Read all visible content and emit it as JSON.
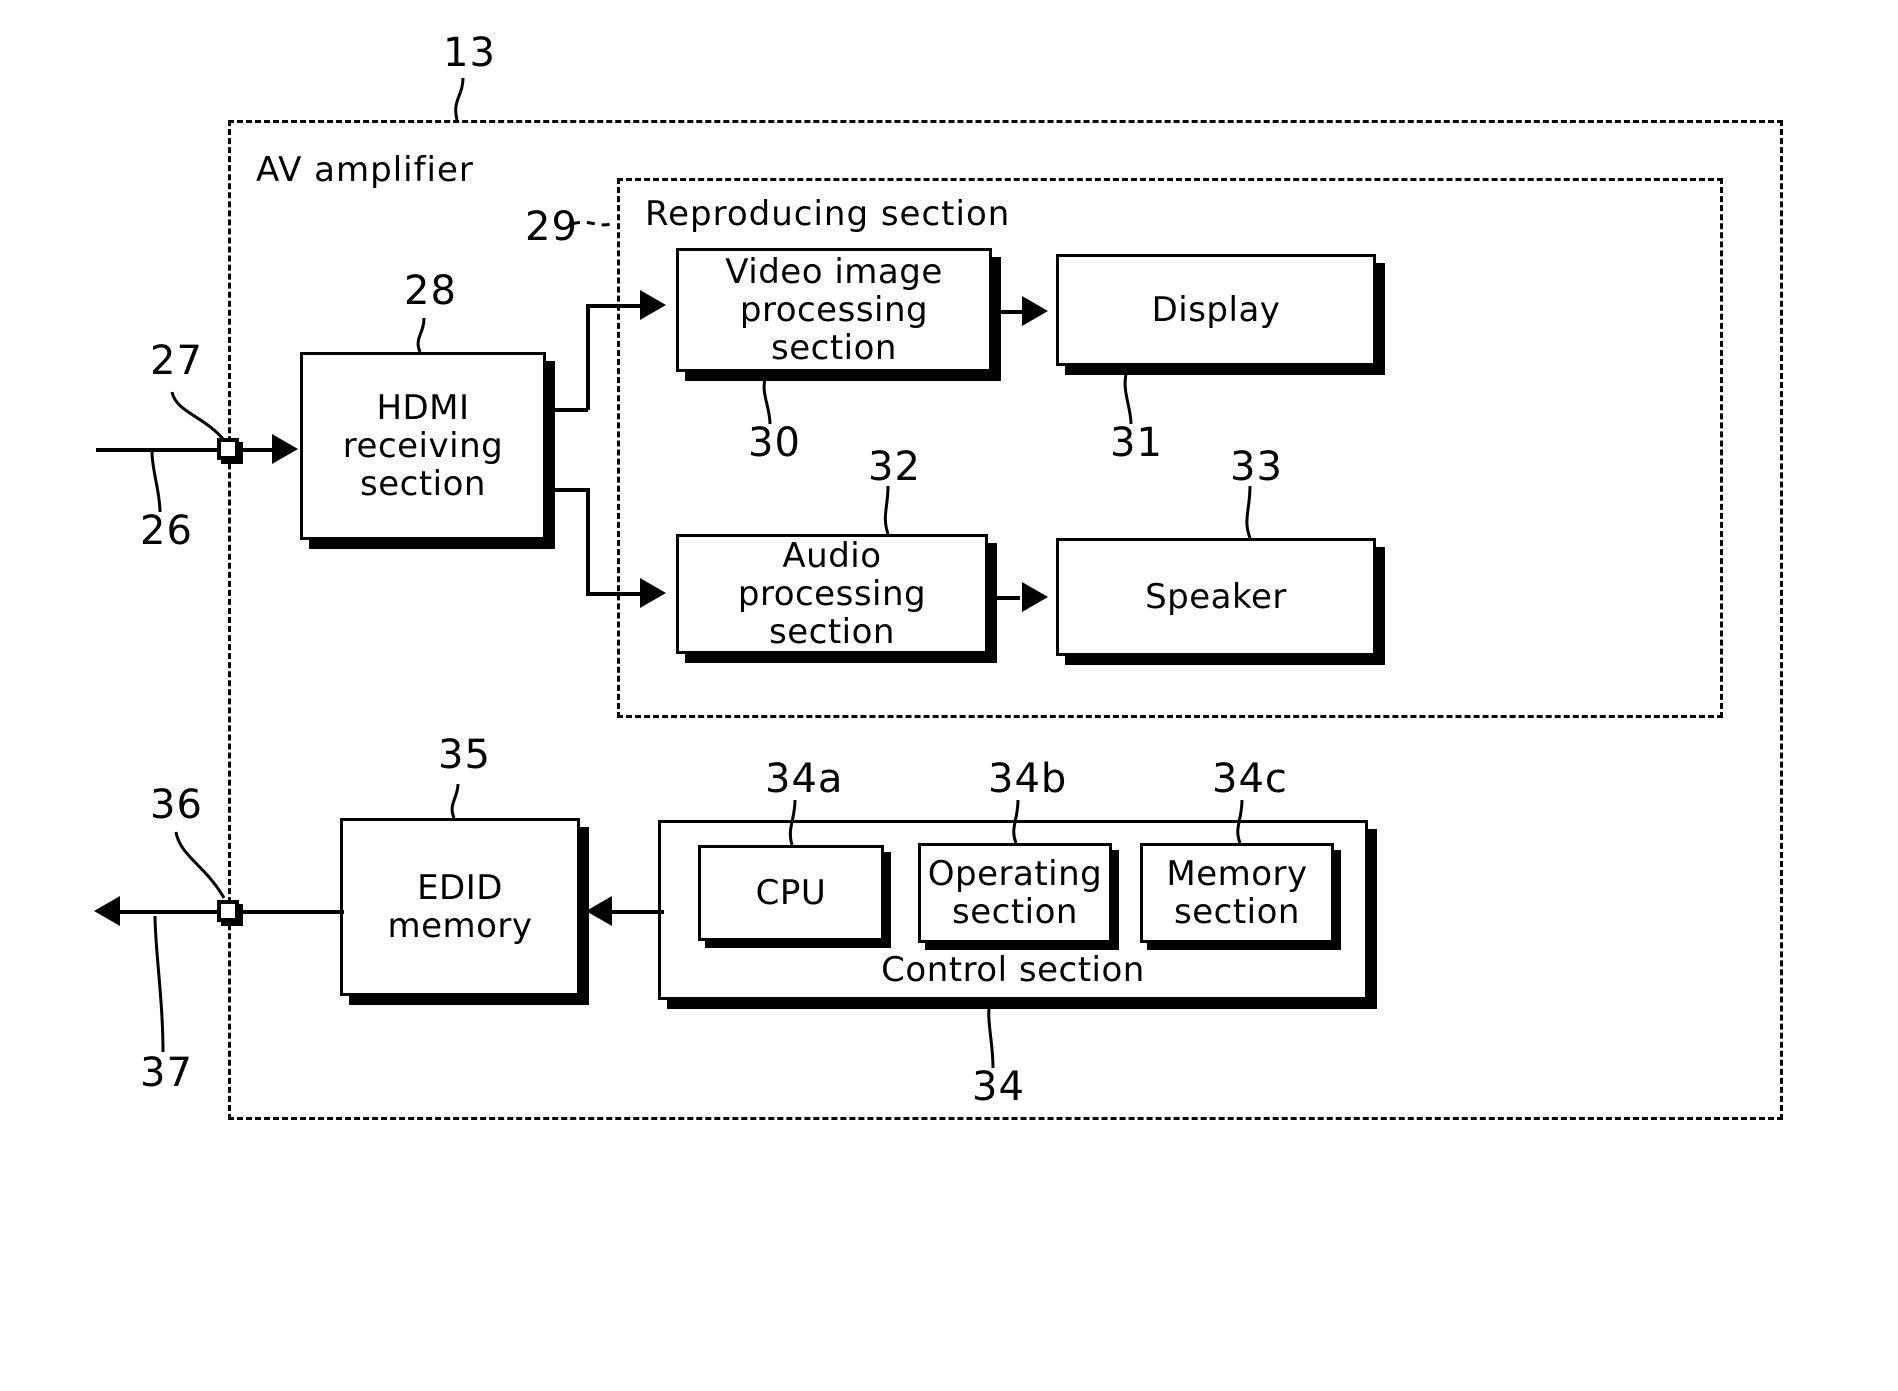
{
  "figure": {
    "type": "block-diagram",
    "outer": {
      "label": "AV amplifier",
      "ref": "13"
    },
    "reproducing": {
      "label": "Reproducing section",
      "ref": "29"
    },
    "control": {
      "label": "Control section",
      "ref": "34"
    },
    "blocks": [
      {
        "id": "hdmi",
        "label": "HDMI\nreceiving\nsection",
        "ref": "28"
      },
      {
        "id": "video",
        "label": "Video  image\nprocessing  section",
        "ref": "30"
      },
      {
        "id": "display",
        "label": "Display",
        "ref": "31"
      },
      {
        "id": "audio",
        "label": "Audio  processing\nsection",
        "ref": "32"
      },
      {
        "id": "speaker",
        "label": "Speaker",
        "ref": "33"
      },
      {
        "id": "edid",
        "label": "EDID\nmemory",
        "ref": "35"
      },
      {
        "id": "cpu",
        "label": "CPU",
        "ref": "34a"
      },
      {
        "id": "operating",
        "label": "Operating\nsection",
        "ref": "34b"
      },
      {
        "id": "memory",
        "label": "Memory\nsection",
        "ref": "34c"
      }
    ],
    "terminals": [
      {
        "id": "input-terminal",
        "ref": "27",
        "line_ref": "26"
      },
      {
        "id": "output-terminal",
        "ref": "36",
        "line_ref": "37"
      }
    ],
    "refs": {
      "r13": "13",
      "r26": "26",
      "r27": "27",
      "r28": "28",
      "r29": "29",
      "r30": "30",
      "r31": "31",
      "r32": "32",
      "r33": "33",
      "r34": "34",
      "r34a": "34a",
      "r34b": "34b",
      "r34c": "34c",
      "r35": "35",
      "r36": "36",
      "r37": "37"
    },
    "labels": {
      "av_amplifier": "AV amplifier",
      "reproducing_section": "Reproducing section",
      "control_section": "Control section",
      "hdmi": "HDMI\nreceiving\nsection",
      "video": "Video  image\nprocessing  section",
      "display": "Display",
      "audio": "Audio  processing\nsection",
      "speaker": "Speaker",
      "edid": "EDID\nmemory",
      "cpu": "CPU",
      "operating": "Operating\nsection",
      "memory": "Memory\nsection"
    },
    "colors": {
      "stroke": "#000000",
      "background": "#ffffff"
    }
  }
}
